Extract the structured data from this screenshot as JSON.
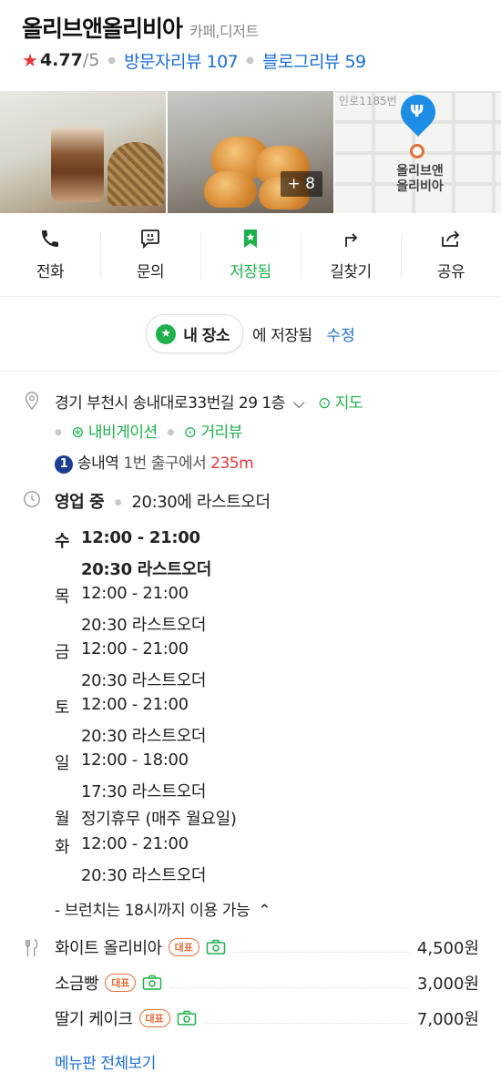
{
  "header": {
    "title": "올리브앤올리비아",
    "category": "카페,디저트",
    "rating": "4.77",
    "rating_max": "/5",
    "visitor_reviews": "방문자리뷰 107",
    "blog_reviews": "블로그리뷰 59"
  },
  "photos": {
    "more_count": "+ 8",
    "map_road": "인로1185번",
    "map_label_line1": "올리브앤",
    "map_label_line2": "올리비아"
  },
  "actions": [
    {
      "label": "전화",
      "icon": "phone-icon"
    },
    {
      "label": "문의",
      "icon": "chat-icon"
    },
    {
      "label": "저장됨",
      "icon": "bookmark-star-icon"
    },
    {
      "label": "길찾기",
      "icon": "directions-icon"
    },
    {
      "label": "공유",
      "icon": "share-icon"
    }
  ],
  "saved": {
    "list_name": "내 장소",
    "saved_text": "에 저장됨",
    "edit_label": "수정"
  },
  "location": {
    "address": "경기 부천시 송내대로33번길 29 1층",
    "map_link": "지도",
    "navigation_link": "내비게이션",
    "street_view_link": "거리뷰",
    "subway_line": "1",
    "station": "송내역",
    "exit_text": "1번 출구에서",
    "distance": "235m"
  },
  "hours": {
    "status": "영업 중",
    "last_order_summary": "20:30에 라스트오더",
    "days": [
      {
        "day": "수",
        "time": "12:00 - 21:00",
        "last": "20:30 라스트오더"
      },
      {
        "day": "목",
        "time": "12:00 - 21:00",
        "last": "20:30 라스트오더"
      },
      {
        "day": "금",
        "time": "12:00 - 21:00",
        "last": "20:30 라스트오더"
      },
      {
        "day": "토",
        "time": "12:00 - 21:00",
        "last": "20:30 라스트오더"
      },
      {
        "day": "일",
        "time": "12:00 - 18:00",
        "last": "17:30 라스트오더"
      },
      {
        "day": "월",
        "time": "정기휴무 (매주 월요일)",
        "last": ""
      },
      {
        "day": "화",
        "time": "12:00 - 21:00",
        "last": "20:30 라스트오더"
      }
    ],
    "note": "- 브런치는 18시까지 이용 가능"
  },
  "menu": {
    "items": [
      {
        "name": "화이트 올리비아",
        "badge": "대표",
        "price": "4,500원"
      },
      {
        "name": "소금빵",
        "badge": "대표",
        "price": "3,000원"
      },
      {
        "name": "딸기 케이크",
        "badge": "대표",
        "price": "7,000원"
      }
    ],
    "view_all": "메뉴판 전체보기"
  },
  "colors": {
    "accent_green": "#1db04b",
    "link_blue": "#1a6fd1",
    "star_red": "#e5383b",
    "badge_orange": "#e0703a"
  }
}
